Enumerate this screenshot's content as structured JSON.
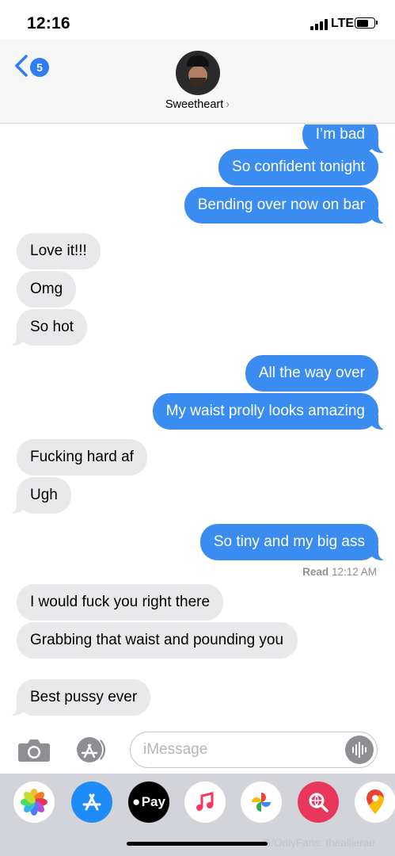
{
  "status_bar": {
    "time": "12:16",
    "network": "LTE"
  },
  "header": {
    "back_count": "5",
    "contact_name": "Sweetheart",
    "chevron": "›"
  },
  "messages": [
    {
      "direction": "out",
      "text": "I’m bad"
    },
    {
      "direction": "out",
      "text": "So confident tonight"
    },
    {
      "direction": "out",
      "text": "Bending over now on bar"
    },
    {
      "direction": "in",
      "text": "Love it!!!"
    },
    {
      "direction": "in",
      "text": "Omg"
    },
    {
      "direction": "in",
      "text": "So hot"
    },
    {
      "direction": "out",
      "text": "All the way over"
    },
    {
      "direction": "out",
      "text": "My waist prolly looks amazing"
    },
    {
      "direction": "in",
      "text": "Fucking hard af"
    },
    {
      "direction": "in",
      "text": "Ugh"
    },
    {
      "direction": "out",
      "text": "So tiny and my big ass"
    },
    {
      "direction": "in",
      "text": "I would fuck you right there"
    },
    {
      "direction": "in",
      "text": "Grabbing that waist and pounding you"
    },
    {
      "direction": "in",
      "text": "Best pussy ever"
    }
  ],
  "read_receipt": {
    "label": "Read",
    "time": "12:12 AM"
  },
  "composer": {
    "placeholder": "iMessage"
  },
  "app_drawer": {
    "apps": [
      {
        "icon": "photos-icon"
      },
      {
        "icon": "app-store-icon"
      },
      {
        "icon": "apple-pay-icon",
        "label": "Pay"
      },
      {
        "icon": "music-icon"
      },
      {
        "icon": "google-photos-icon"
      },
      {
        "icon": "web-search-icon"
      },
      {
        "icon": "google-maps-icon"
      }
    ]
  },
  "watermark": "G/OnlyFans: theallierae",
  "colors": {
    "outgoing_bubble": "#3a8cf0",
    "incoming_bubble": "#e9e9eb",
    "accent": "#2f7cf6"
  }
}
